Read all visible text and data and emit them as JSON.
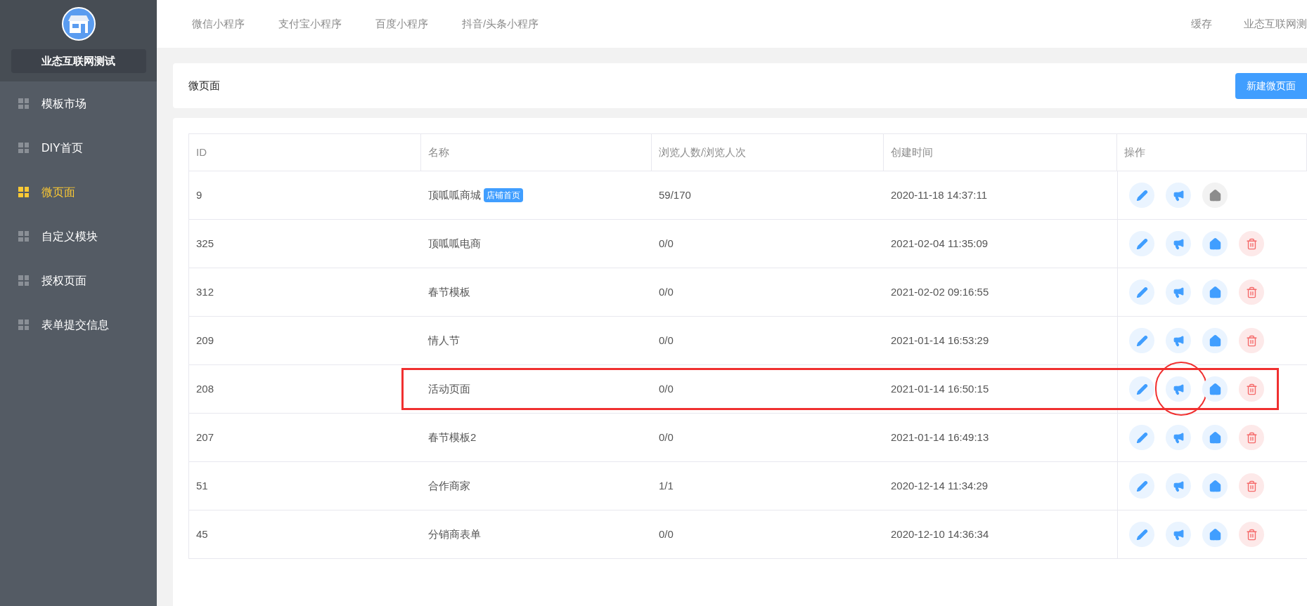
{
  "sidebar": {
    "shop_name": "业态互联网测试",
    "items": [
      {
        "label": "模板市场",
        "selected": false
      },
      {
        "label": "DIY首页",
        "selected": false
      },
      {
        "label": "微页面",
        "selected": true
      },
      {
        "label": "自定义模块",
        "selected": false
      },
      {
        "label": "授权页面",
        "selected": false
      },
      {
        "label": "表单提交信息",
        "selected": false
      }
    ]
  },
  "top_nav": {
    "tabs": [
      "微信小程序",
      "支付宝小程序",
      "百度小程序",
      "抖音/头条小程序"
    ],
    "right": [
      "缓存",
      "业态互联网测"
    ]
  },
  "header": {
    "title": "微页面",
    "button": "新建微页面"
  },
  "table": {
    "columns": [
      "ID",
      "名称",
      "浏览人数/浏览人次",
      "创建时间",
      "操作"
    ],
    "rows": [
      {
        "id": "9",
        "name": "顶呱呱商城",
        "badge": "店铺首页",
        "views": "59/170",
        "created": "2020-11-18 14:37:11",
        "highlighted": false,
        "actions": [
          {
            "kind": "edit",
            "circled": false
          },
          {
            "kind": "promote",
            "circled": false
          },
          {
            "kind": "home",
            "enabled": false,
            "circled": false
          }
        ]
      },
      {
        "id": "325",
        "name": "顶呱呱电商",
        "views": "0/0",
        "created": "2021-02-04 11:35:09",
        "highlighted": false,
        "actions": [
          {
            "kind": "edit",
            "circled": false
          },
          {
            "kind": "promote",
            "circled": false
          },
          {
            "kind": "home",
            "enabled": true,
            "circled": false
          },
          {
            "kind": "delete",
            "circled": false
          }
        ]
      },
      {
        "id": "312",
        "name": "春节模板",
        "views": "0/0",
        "created": "2021-02-02 09:16:55",
        "highlighted": false,
        "actions": [
          {
            "kind": "edit",
            "circled": false
          },
          {
            "kind": "promote",
            "circled": false
          },
          {
            "kind": "home",
            "enabled": true,
            "circled": false
          },
          {
            "kind": "delete",
            "circled": false
          }
        ]
      },
      {
        "id": "209",
        "name": "情人节",
        "views": "0/0",
        "created": "2021-01-14 16:53:29",
        "highlighted": false,
        "actions": [
          {
            "kind": "edit",
            "circled": false
          },
          {
            "kind": "promote",
            "circled": false
          },
          {
            "kind": "home",
            "enabled": true,
            "circled": false
          },
          {
            "kind": "delete",
            "circled": false
          }
        ]
      },
      {
        "id": "208",
        "name": "活动页面",
        "views": "0/0",
        "created": "2021-01-14 16:50:15",
        "highlighted": true,
        "actions": [
          {
            "kind": "edit",
            "circled": false
          },
          {
            "kind": "promote",
            "circled": true
          },
          {
            "kind": "home",
            "enabled": true,
            "circled": false
          },
          {
            "kind": "delete",
            "circled": false
          }
        ]
      },
      {
        "id": "207",
        "name": "春节模板2",
        "views": "0/0",
        "created": "2021-01-14 16:49:13",
        "highlighted": false,
        "actions": [
          {
            "kind": "edit",
            "circled": false
          },
          {
            "kind": "promote",
            "circled": false
          },
          {
            "kind": "home",
            "enabled": true,
            "circled": false
          },
          {
            "kind": "delete",
            "circled": false
          }
        ]
      },
      {
        "id": "51",
        "name": "合作商家",
        "views": "1/1",
        "created": "2020-12-14 11:34:29",
        "highlighted": false,
        "actions": [
          {
            "kind": "edit",
            "circled": false
          },
          {
            "kind": "promote",
            "circled": false
          },
          {
            "kind": "home",
            "enabled": true,
            "circled": false
          },
          {
            "kind": "delete",
            "circled": false
          }
        ]
      },
      {
        "id": "45",
        "name": "分销商表单",
        "views": "0/0",
        "created": "2020-12-10 14:36:34",
        "highlighted": false,
        "actions": [
          {
            "kind": "edit",
            "circled": false
          },
          {
            "kind": "promote",
            "circled": false
          },
          {
            "kind": "home",
            "enabled": true,
            "circled": false
          },
          {
            "kind": "delete",
            "circled": false
          }
        ]
      }
    ]
  }
}
